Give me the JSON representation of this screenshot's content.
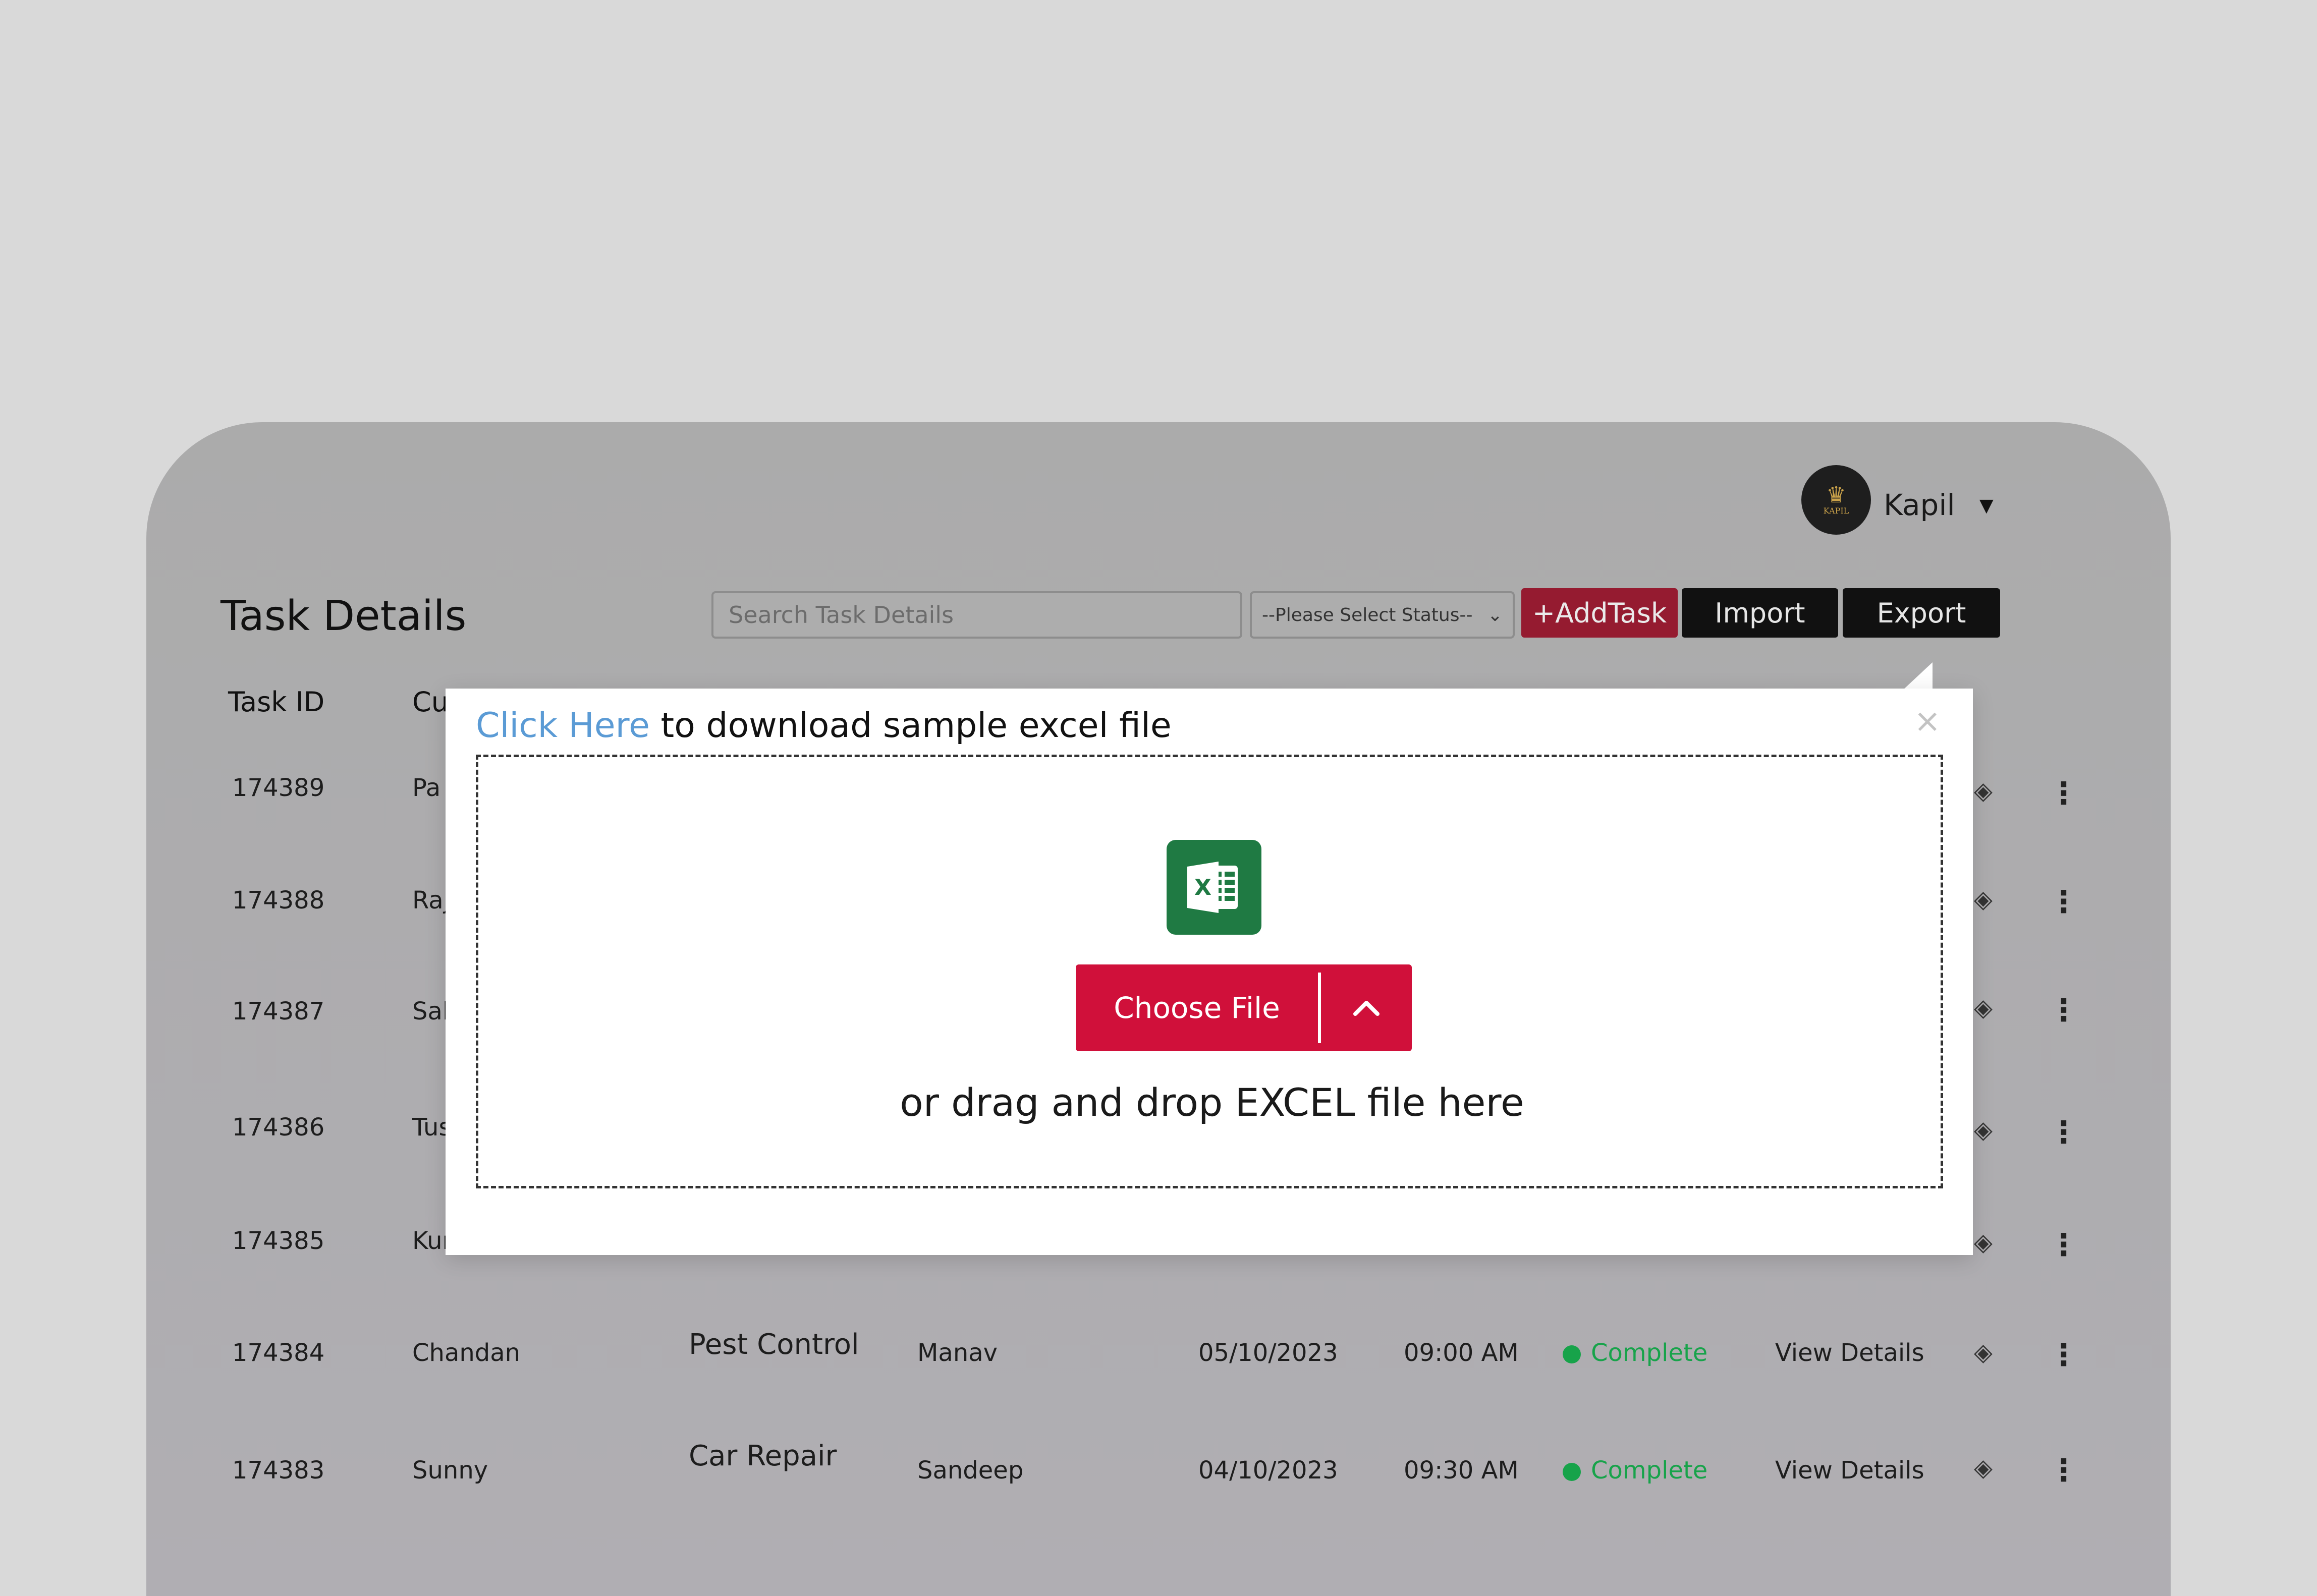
{
  "user": {
    "name": "Kapil",
    "avatar_brand": "KAPIL"
  },
  "page": {
    "title": "Task Details"
  },
  "toolbar": {
    "search_placeholder": "Search Task Details",
    "status_placeholder": "--Please Select Status--",
    "add_task_label": "+AddTask",
    "import_label": "Import",
    "export_label": "Export"
  },
  "table": {
    "headers": {
      "task_id": "Task ID",
      "customer_partial": "Cu"
    },
    "rows": [
      {
        "id": "174389",
        "customer": "Pa"
      },
      {
        "id": "174388",
        "customer": "Raj"
      },
      {
        "id": "174387",
        "customer": "Sal"
      },
      {
        "id": "174386",
        "customer": "Tus"
      },
      {
        "id": "174385",
        "customer": "Kur"
      },
      {
        "id": "174384",
        "customer": "Chandan",
        "service": "Pest Control",
        "assignee": "Manav",
        "date": "05/10/2023",
        "time": "09:00 AM",
        "status": "Complete",
        "action": "View Details"
      },
      {
        "id": "174383",
        "customer": "Sunny",
        "service": "Car Repair",
        "assignee": "Sandeep",
        "date": "04/10/2023",
        "time": "09:30 AM",
        "status": "Complete",
        "action": "View Details"
      }
    ]
  },
  "modal": {
    "link_text": "Click Here",
    "instruction": " to download sample excel file",
    "choose_file_label": "Choose File",
    "drag_text": "or drag and drop EXCEL file here",
    "close_glyph": "×"
  },
  "colors": {
    "accent_red": "#d0103a",
    "status_green": "#17a34a",
    "link_blue": "#5b9bd5",
    "excel_green": "#1f7a43"
  },
  "icons": [
    "crown-logo-icon",
    "caret-down-icon",
    "select-chevron-icon",
    "excel-icon",
    "chevron-up-icon",
    "close-icon",
    "diamond-icon",
    "kebab-menu-icon"
  ]
}
